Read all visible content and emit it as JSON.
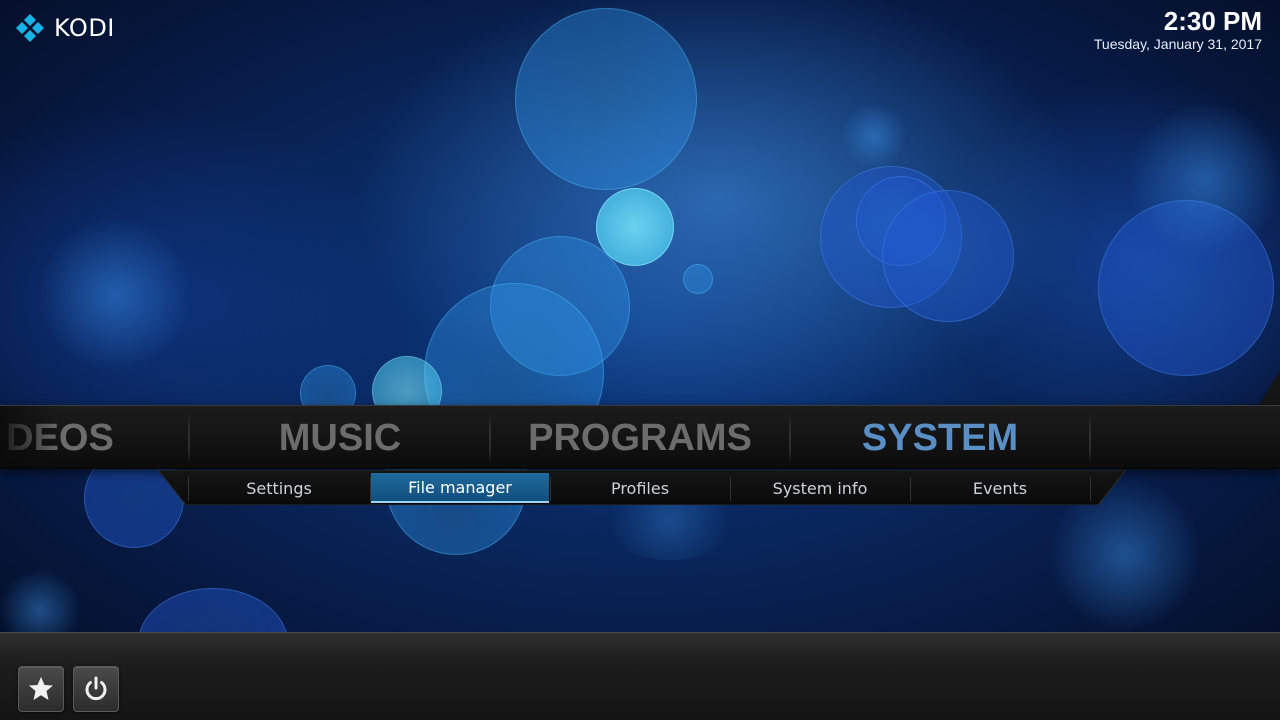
{
  "app": {
    "logo_text": "KODI",
    "logo_icon": "kodi-logo-icon"
  },
  "clock": {
    "time": "2:30 PM",
    "date": "Tuesday, January 31, 2017"
  },
  "main_menu": {
    "items": [
      {
        "label": "DEOS",
        "active": false
      },
      {
        "label": "MUSIC",
        "active": false
      },
      {
        "label": "PROGRAMS",
        "active": false
      },
      {
        "label": "SYSTEM",
        "active": true
      }
    ]
  },
  "sub_menu": {
    "items": [
      {
        "label": "Settings",
        "active": false
      },
      {
        "label": "File manager",
        "active": true
      },
      {
        "label": "Profiles",
        "active": false
      },
      {
        "label": "System info",
        "active": false
      },
      {
        "label": "Events",
        "active": false
      }
    ]
  },
  "bottom_buttons": [
    {
      "icon": "star-icon"
    },
    {
      "icon": "power-icon"
    }
  ],
  "colors": {
    "active_main": "#5a8fc6",
    "inactive_main": "#6c6c6c",
    "submenu_highlight": "#1f6a9c",
    "background": "#0d3c86"
  }
}
